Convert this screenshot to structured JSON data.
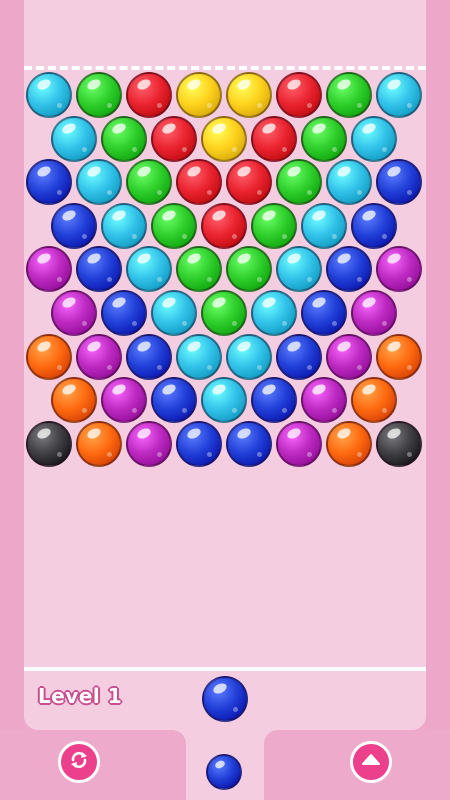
{
  "colors": {
    "cyan": "#33c3ea",
    "green": "#2fcf2c",
    "red": "#ea2430",
    "yellow": "#ffd21e",
    "blue": "#2140d8",
    "magenta": "#bd2ac2",
    "orange": "#ff6a10",
    "gray": "#3f3f44",
    "pink_accent": "#ec3f8c",
    "wall": "#eda8c9",
    "board": "#f4cde1"
  },
  "level_label": "Level 1",
  "bubble_grid": [
    [
      "cyan",
      "green",
      "red",
      "yellow",
      "yellow",
      "red",
      "green",
      "cyan"
    ],
    [
      "cyan",
      "green",
      "red",
      "yellow",
      "red",
      "green",
      "cyan"
    ],
    [
      "blue",
      "cyan",
      "green",
      "red",
      "red",
      "green",
      "cyan",
      "blue"
    ],
    [
      "blue",
      "cyan",
      "green",
      "red",
      "green",
      "cyan",
      "blue"
    ],
    [
      "magenta",
      "blue",
      "cyan",
      "green",
      "green",
      "cyan",
      "blue",
      "magenta"
    ],
    [
      "magenta",
      "blue",
      "cyan",
      "green",
      "cyan",
      "blue",
      "magenta"
    ],
    [
      "orange",
      "magenta",
      "blue",
      "cyan",
      "cyan",
      "blue",
      "magenta",
      "orange"
    ],
    [
      "orange",
      "magenta",
      "blue",
      "cyan",
      "blue",
      "magenta",
      "orange"
    ],
    [
      "gray",
      "orange",
      "magenta",
      "blue",
      "blue",
      "magenta",
      "orange",
      "gray"
    ]
  ],
  "current_bubble": "blue",
  "next_bubble": "blue",
  "buttons": {
    "swap": "swap-icon",
    "up": "up-arrow-icon"
  }
}
